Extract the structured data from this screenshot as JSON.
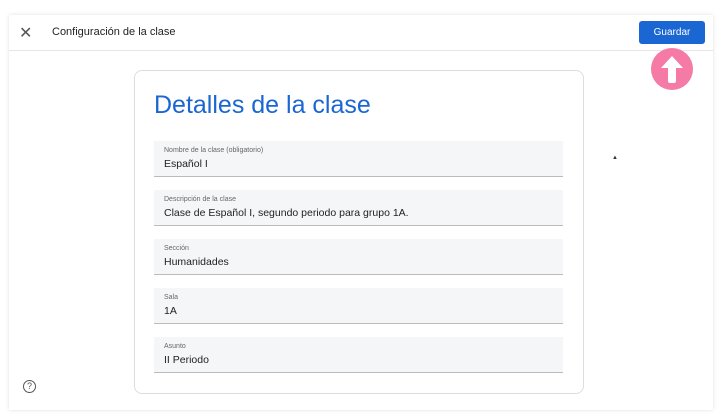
{
  "header": {
    "title": "Configuración de la clase",
    "save_label": "Guardar"
  },
  "card": {
    "heading": "Detalles de la clase",
    "fields": [
      {
        "label": "Nombre de la clase (obligatorio)",
        "value": "Español I"
      },
      {
        "label": "Descripción de la clase",
        "value": "Clase de Español I, segundo periodo para grupo 1A."
      },
      {
        "label": "Sección",
        "value": "Humanidades"
      },
      {
        "label": "Sala",
        "value": "1A"
      },
      {
        "label": "Asunto",
        "value": "II Periodo"
      }
    ]
  },
  "help_icon": "?"
}
